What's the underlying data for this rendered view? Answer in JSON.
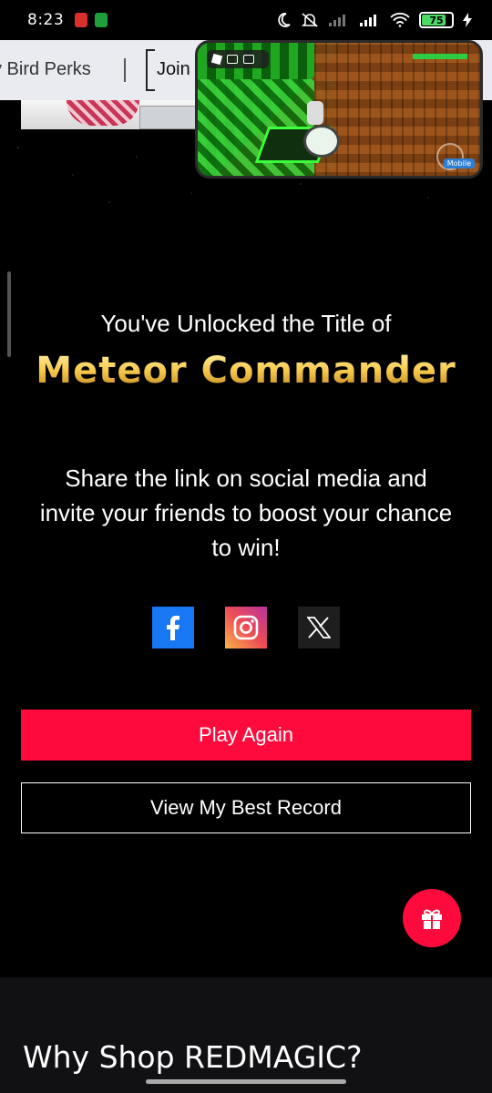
{
  "status_bar": {
    "time": "8:23",
    "battery_level": "75",
    "battery_fraction": 0.75,
    "icons": [
      "moon-icon",
      "mute-icon",
      "signal-icon",
      "signal-icon",
      "wifi-icon",
      "battery-icon",
      "charging-icon"
    ]
  },
  "nav": {
    "item_1": "y Bird Perks",
    "item_2": "Join"
  },
  "pip": {
    "tag": "Mobile"
  },
  "result": {
    "unlock_label": "You've Unlocked the Title of",
    "title_name": "Meteor Commander",
    "share_text": "Share the link on social media and invite your friends to boost your chance to win!"
  },
  "social": [
    {
      "name": "facebook-icon",
      "color": "#1877f2"
    },
    {
      "name": "instagram-icon",
      "color": "#ee4c56"
    },
    {
      "name": "x-icon",
      "color": "#1e1e1e"
    }
  ],
  "buttons": {
    "play_again": "Play Again",
    "best_record": "View My Best Record"
  },
  "colors": {
    "accent": "#ff0a3c",
    "gold": "#f1c64e",
    "background": "#000000"
  },
  "footer": {
    "heading": "Why Shop REDMAGIC?"
  }
}
